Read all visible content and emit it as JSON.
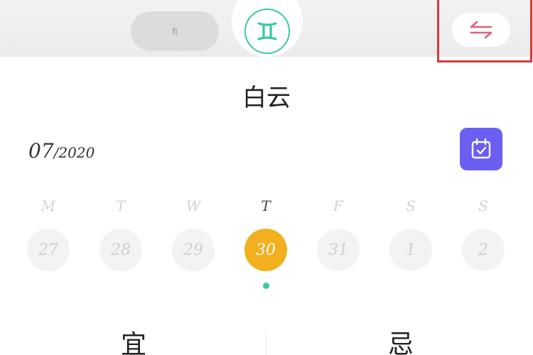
{
  "header": {
    "left_tab_label": "fi",
    "zodiac_symbol": "♊",
    "switch_icon": "swap-arrows-icon",
    "accent_color": "#38c9a8",
    "switch_color": "#e0607a",
    "highlight_color": "#d63a3a"
  },
  "title": "白云",
  "date": {
    "month": "07",
    "separator": "/",
    "year": "2020"
  },
  "calendar_button": {
    "icon": "calendar-check-icon",
    "color": "#6a5ff0"
  },
  "week": {
    "weekdays": [
      "M",
      "T",
      "W",
      "T",
      "F",
      "S",
      "S"
    ],
    "days": [
      "27",
      "28",
      "29",
      "30",
      "31",
      "1",
      "2"
    ],
    "selected_index": 3,
    "selected_color": "#f2b01e"
  },
  "almanac": {
    "good_label": "宜",
    "bad_label": "忌"
  }
}
